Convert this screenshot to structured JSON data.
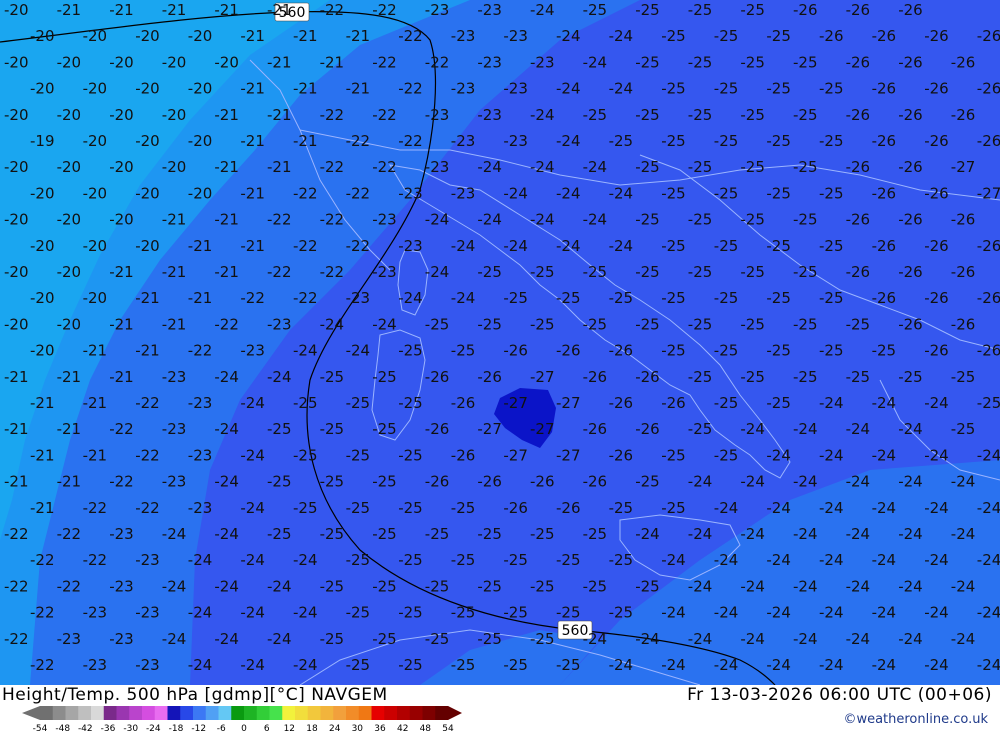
{
  "map": {
    "palette": {
      "t19": "#1aa6f0",
      "t20": "#1aa6f0",
      "t21": "#1e96f2",
      "t23": "#2a72f0",
      "t25": "#3557ef",
      "t27": "#0b14c8",
      "coast": "#9bb4ff",
      "contour": "#000000"
    },
    "contour_labels": [
      "560",
      "560"
    ],
    "rows": [
      [
        "-20",
        "-21",
        "-21",
        "-21",
        "-21",
        "-21",
        "-22",
        "-22",
        "-23",
        "-23",
        "-24",
        "-25",
        "-25",
        "-25",
        "-25",
        "-26",
        "-26",
        "-26"
      ],
      [
        "-20",
        "-20",
        "-20",
        "-20",
        "-21",
        "-21",
        "-21",
        "-22",
        "-23",
        "-23",
        "-24",
        "-24",
        "-25",
        "-25",
        "-25",
        "-26",
        "-26",
        "-26",
        "-26"
      ],
      [
        "-20",
        "-20",
        "-20",
        "-20",
        "-20",
        "-21",
        "-21",
        "-22",
        "-22",
        "-23",
        "-23",
        "-24",
        "-25",
        "-25",
        "-25",
        "-25",
        "-26",
        "-26",
        "-26",
        "-26"
      ],
      [
        "-20",
        "-20",
        "-20",
        "-20",
        "-21",
        "-21",
        "-21",
        "-22",
        "-23",
        "-23",
        "-24",
        "-24",
        "-25",
        "-25",
        "-25",
        "-25",
        "-26",
        "-26",
        "-26",
        "-26"
      ],
      [
        "-20",
        "-20",
        "-20",
        "-20",
        "-21",
        "-21",
        "-22",
        "-22",
        "-23",
        "-23",
        "-24",
        "-25",
        "-25",
        "-25",
        "-25",
        "-25",
        "-26",
        "-26",
        "-26",
        "-26"
      ],
      [
        "-19",
        "-20",
        "-20",
        "-20",
        "-21",
        "-21",
        "-22",
        "-22",
        "-23",
        "-23",
        "-24",
        "-25",
        "-25",
        "-25",
        "-25",
        "-25",
        "-26",
        "-26",
        "-26",
        "-26"
      ],
      [
        "-20",
        "-20",
        "-20",
        "-20",
        "-21",
        "-21",
        "-22",
        "-22",
        "-23",
        "-24",
        "-24",
        "-24",
        "-25",
        "-25",
        "-25",
        "-25",
        "-26",
        "-26",
        "-27",
        "-26"
      ],
      [
        "-20",
        "-20",
        "-20",
        "-20",
        "-21",
        "-22",
        "-22",
        "-23",
        "-23",
        "-24",
        "-24",
        "-24",
        "-25",
        "-25",
        "-25",
        "-25",
        "-26",
        "-26",
        "-27",
        "-26"
      ],
      [
        "-20",
        "-20",
        "-20",
        "-21",
        "-21",
        "-22",
        "-22",
        "-23",
        "-24",
        "-24",
        "-24",
        "-24",
        "-25",
        "-25",
        "-25",
        "-25",
        "-26",
        "-26",
        "-26",
        "-26"
      ],
      [
        "-20",
        "-20",
        "-20",
        "-21",
        "-21",
        "-22",
        "-22",
        "-23",
        "-24",
        "-24",
        "-24",
        "-24",
        "-25",
        "-25",
        "-25",
        "-25",
        "-26",
        "-26",
        "-26",
        "-26"
      ],
      [
        "-20",
        "-20",
        "-21",
        "-21",
        "-21",
        "-22",
        "-22",
        "-23",
        "-24",
        "-25",
        "-25",
        "-25",
        "-25",
        "-25",
        "-25",
        "-25",
        "-26",
        "-26",
        "-26",
        "-26"
      ],
      [
        "-20",
        "-20",
        "-21",
        "-21",
        "-22",
        "-22",
        "-23",
        "-24",
        "-24",
        "-25",
        "-25",
        "-25",
        "-25",
        "-25",
        "-25",
        "-25",
        "-26",
        "-26",
        "-26",
        "-26"
      ],
      [
        "-20",
        "-20",
        "-21",
        "-21",
        "-22",
        "-23",
        "-24",
        "-24",
        "-25",
        "-25",
        "-25",
        "-25",
        "-25",
        "-25",
        "-25",
        "-25",
        "-25",
        "-26",
        "-26",
        "-26"
      ],
      [
        "-20",
        "-21",
        "-21",
        "-22",
        "-23",
        "-24",
        "-24",
        "-25",
        "-25",
        "-26",
        "-26",
        "-26",
        "-25",
        "-25",
        "-25",
        "-25",
        "-25",
        "-26",
        "-26",
        "-26"
      ],
      [
        "-21",
        "-21",
        "-21",
        "-23",
        "-24",
        "-24",
        "-25",
        "-25",
        "-26",
        "-26",
        "-27",
        "-26",
        "-26",
        "-25",
        "-25",
        "-25",
        "-25",
        "-25",
        "-25",
        "-26"
      ],
      [
        "-21",
        "-21",
        "-22",
        "-23",
        "-24",
        "-25",
        "-25",
        "-25",
        "-26",
        "-27",
        "-27",
        "-26",
        "-26",
        "-25",
        "-25",
        "-24",
        "-24",
        "-24",
        "-25",
        "-25"
      ],
      [
        "-21",
        "-21",
        "-22",
        "-23",
        "-24",
        "-25",
        "-25",
        "-25",
        "-26",
        "-27",
        "-27",
        "-26",
        "-26",
        "-25",
        "-24",
        "-24",
        "-24",
        "-24",
        "-25",
        "-25"
      ],
      [
        "-21",
        "-21",
        "-22",
        "-23",
        "-24",
        "-25",
        "-25",
        "-25",
        "-26",
        "-27",
        "-27",
        "-26",
        "-25",
        "-25",
        "-24",
        "-24",
        "-24",
        "-24",
        "-24",
        "-25"
      ],
      [
        "-21",
        "-21",
        "-22",
        "-23",
        "-24",
        "-25",
        "-25",
        "-25",
        "-26",
        "-26",
        "-26",
        "-26",
        "-25",
        "-24",
        "-24",
        "-24",
        "-24",
        "-24",
        "-24",
        "-24"
      ],
      [
        "-21",
        "-22",
        "-22",
        "-23",
        "-24",
        "-25",
        "-25",
        "-25",
        "-25",
        "-26",
        "-26",
        "-25",
        "-25",
        "-24",
        "-24",
        "-24",
        "-24",
        "-24",
        "-24",
        "-24"
      ],
      [
        "-22",
        "-22",
        "-23",
        "-24",
        "-24",
        "-25",
        "-25",
        "-25",
        "-25",
        "-25",
        "-25",
        "-25",
        "-24",
        "-24",
        "-24",
        "-24",
        "-24",
        "-24",
        "-24",
        "-24"
      ],
      [
        "-22",
        "-22",
        "-23",
        "-24",
        "-24",
        "-24",
        "-25",
        "-25",
        "-25",
        "-25",
        "-25",
        "-25",
        "-24",
        "-24",
        "-24",
        "-24",
        "-24",
        "-24",
        "-24",
        "-24"
      ],
      [
        "-22",
        "-22",
        "-23",
        "-24",
        "-24",
        "-24",
        "-25",
        "-25",
        "-25",
        "-25",
        "-25",
        "-25",
        "-25",
        "-24",
        "-24",
        "-24",
        "-24",
        "-24",
        "-24",
        "-24"
      ],
      [
        "-22",
        "-23",
        "-23",
        "-24",
        "-24",
        "-24",
        "-25",
        "-25",
        "-25",
        "-25",
        "-25",
        "-25",
        "-24",
        "-24",
        "-24",
        "-24",
        "-24",
        "-24",
        "-24",
        "-24"
      ],
      [
        "-22",
        "-23",
        "-23",
        "-24",
        "-24",
        "-24",
        "-25",
        "-25",
        "-25",
        "-25",
        "-25",
        "-24",
        "-24",
        "-24",
        "-24",
        "-24",
        "-24",
        "-24",
        "-24",
        "-24"
      ],
      [
        "-22",
        "-23",
        "-23",
        "-24",
        "-24",
        "-24",
        "-25",
        "-25",
        "-25",
        "-25",
        "-25",
        "-24",
        "-24",
        "-24",
        "-24",
        "-24",
        "-24",
        "-24",
        "-24",
        "-24"
      ],
      [
        "-22",
        "-23",
        "-23",
        "-24",
        "-24",
        "-24",
        "-25",
        "-25",
        "-25",
        "-25",
        "-25",
        "-24",
        "-24",
        "-24",
        "-24",
        "-24",
        "-24",
        "-24",
        "-24",
        "-24"
      ]
    ]
  },
  "footer": {
    "title": "Height/Temp. 500 hPa [gdmp][°C] NAVGEM",
    "time": "Fr 13-03-2026 06:00 UTC (00+06)",
    "credit": "©weatheronline.co.uk"
  },
  "colorbar": {
    "ticks": [
      "-54",
      "-48",
      "-42",
      "-36",
      "-30",
      "-24",
      "-18",
      "-12",
      "-6",
      "0",
      "6",
      "12",
      "18",
      "24",
      "30",
      "36",
      "42",
      "48",
      "54"
    ],
    "colors": [
      "#707070",
      "#8c8c8c",
      "#a6a6a6",
      "#bfbfbf",
      "#d9d9d9",
      "#7a2a8a",
      "#9a36b0",
      "#ba44cc",
      "#d44ee0",
      "#e86cf0",
      "#1414b8",
      "#2848e8",
      "#3c78f4",
      "#50a0f4",
      "#64c8f4",
      "#0a9a10",
      "#1eb424",
      "#32ce38",
      "#46e24c",
      "#f2f23c",
      "#f2de3c",
      "#f2c83c",
      "#f2b43c",
      "#f2a03c",
      "#f28c28",
      "#f07814",
      "#e60000",
      "#cc0000",
      "#b20000",
      "#980000",
      "#7e0000",
      "#640000"
    ]
  }
}
